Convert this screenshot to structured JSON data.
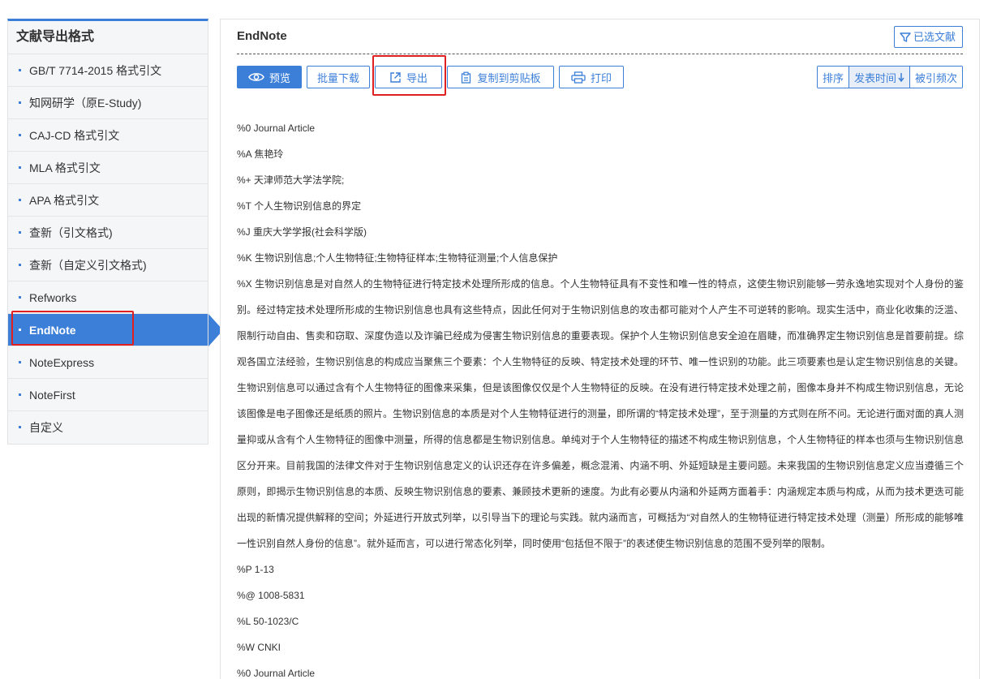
{
  "sidebar": {
    "title": "文献导出格式",
    "items": [
      {
        "label": "GB/T 7714-2015 格式引文"
      },
      {
        "label": "知网研学（原E-Study)"
      },
      {
        "label": "CAJ-CD 格式引文"
      },
      {
        "label": "MLA 格式引文"
      },
      {
        "label": "APA 格式引文"
      },
      {
        "label": "查新（引文格式)"
      },
      {
        "label": "查新（自定义引文格式)"
      },
      {
        "label": "Refworks"
      },
      {
        "label": "EndNote"
      },
      {
        "label": "NoteExpress"
      },
      {
        "label": "NoteFirst"
      },
      {
        "label": "自定义"
      }
    ],
    "active_index": 8
  },
  "main": {
    "title": "EndNote",
    "selected_label": "已选文献",
    "toolbar": {
      "preview": "预览",
      "batch_download": "批量下载",
      "export": "导出",
      "copy_clipboard": "复制到剪贴板",
      "print": "打印"
    },
    "sort": {
      "label": "排序",
      "publish_time": "发表时间",
      "cited": "被引频次"
    },
    "lines": {
      "type": "%0 Journal Article",
      "author": "%A 焦艳玲",
      "affiliation": "%+ 天津师范大学法学院;",
      "title": "%T 个人生物识别信息的界定",
      "journal": "%J 重庆大学学报(社会科学版)",
      "keywords": "%K 生物识别信息;个人生物特征;生物特征样本;生物特征测量;个人信息保护",
      "abstract": "%X 生物识别信息是对自然人的生物特征进行特定技术处理所形成的信息。个人生物特征具有不变性和唯一性的特点，这使生物识别能够一劳永逸地实现对个人身份的鉴别。经过特定技术处理所形成的生物识别信息也具有这些特点，因此任何对于生物识别信息的攻击都可能对个人产生不可逆转的影响。现实生活中，商业化收集的泛滥、限制行动自由、售卖和窃取、深度伪造以及诈骗已经成为侵害生物识别信息的重要表现。保护个人生物识别信息安全迫在眉睫，而准确界定生物识别信息是首要前提。综观各国立法经验，生物识别信息的构成应当聚焦三个要素：个人生物特征的反映、特定技术处理的环节、唯一性识别的功能。此三项要素也是认定生物识别信息的关键。生物识别信息可以通过含有个人生物特征的图像来采集，但是该图像仅仅是个人生物特征的反映。在没有进行特定技术处理之前，图像本身并不构成生物识别信息，无论该图像是电子图像还是纸质的照片。生物识别信息的本质是对个人生物特征进行的测量，即所谓的“特定技术处理”，至于测量的方式则在所不问。无论进行面对面的真人测量抑或从含有个人生物特征的图像中测量，所得的信息都是生物识别信息。单纯对于个人生物特征的描述不构成生物识别信息，个人生物特征的样本也须与生物识别信息区分开来。目前我国的法律文件对于生物识别信息定义的认识还存在许多偏差，概念混淆、内涵不明、外延短缺是主要问题。未来我国的生物识别信息定义应当遵循三个原则，即揭示生物识别信息的本质、反映生物识别信息的要素、兼顾技术更新的速度。为此有必要从内涵和外延两方面着手：内涵规定本质与构成，从而为技术更迭可能出现的新情况提供解释的空间；外延进行开放式列举，以引导当下的理论与实践。就内涵而言，可概括为“对自然人的生物特征进行特定技术处理（测量）所形成的能够唯一性识别自然人身份的信息”。就外延而言，可以进行常态化列举，同时使用“包括但不限于”的表述使生物识别信息的范围不受列举的限制。",
      "pages": "%P 1-13",
      "issn": "%@ 1008-5831",
      "cn": "%L 50-1023/C",
      "source": "%W CNKI",
      "type2": "%0 Journal Article"
    }
  },
  "colors": {
    "accent": "#3c7fd9",
    "highlight_box": "#e02020"
  }
}
